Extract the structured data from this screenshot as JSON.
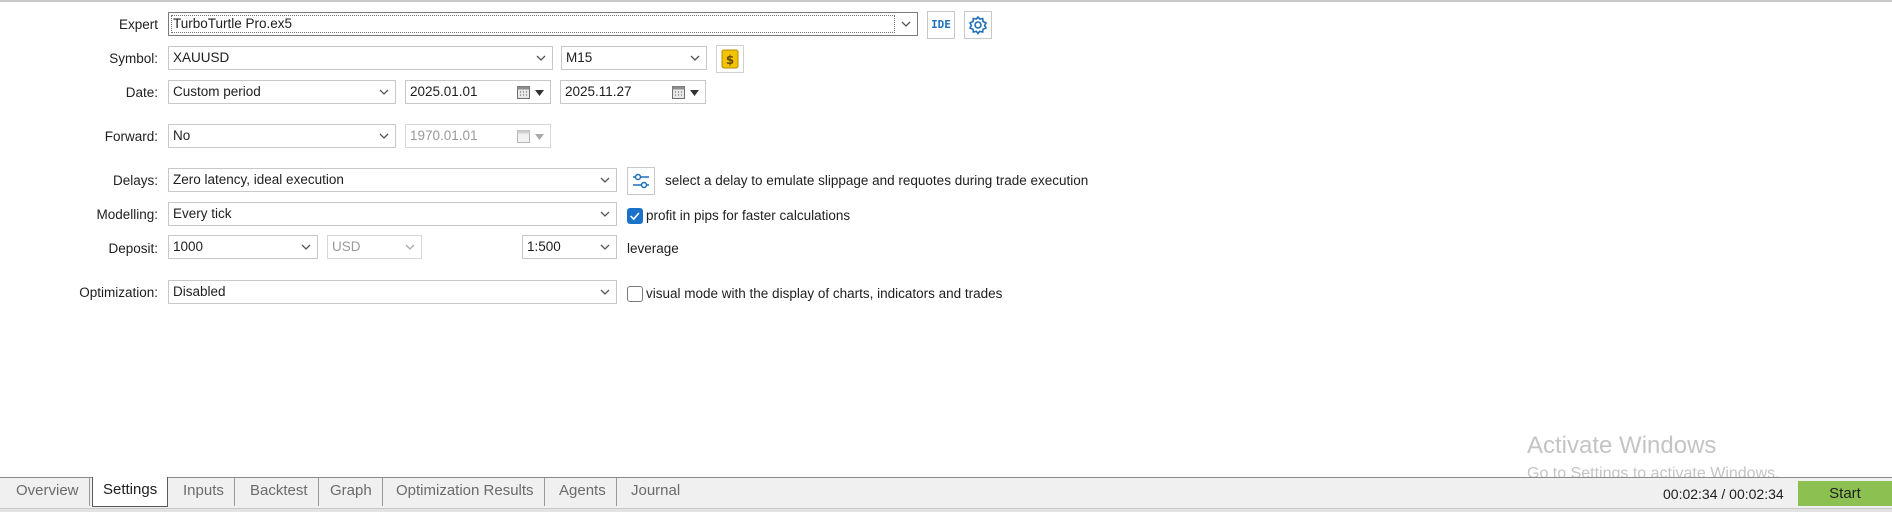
{
  "labels": {
    "expert": "Expert",
    "symbol": "Symbol:",
    "date": "Date:",
    "forward": "Forward:",
    "delays": "Delays:",
    "modelling": "Modelling:",
    "deposit": "Deposit:",
    "optimization": "Optimization:"
  },
  "expert": {
    "value": "TurboTurtle Pro.ex5",
    "ide_label": "IDE",
    "icons": [
      "ide-icon",
      "settings-gear-icon"
    ]
  },
  "symbol": {
    "value": "XAUUSD",
    "timeframe": "M15",
    "icon": "symbol-properties-dollar-icon",
    "accent": "#f2c400"
  },
  "date": {
    "period": "Custom period",
    "from": "2025.01.01",
    "to": "2025.11.27"
  },
  "forward": {
    "value": "No",
    "date": "1970.01.01"
  },
  "delays": {
    "value": "Zero latency, ideal execution",
    "hint": "select a delay to emulate slippage and requotes during trade execution",
    "icon": "delay-settings-icon"
  },
  "modelling": {
    "value": "Every tick",
    "profit_in_pips_label": "profit in pips for faster calculations",
    "profit_in_pips_checked": true
  },
  "deposit": {
    "amount": "1000",
    "currency": "USD",
    "leverage_value": "1:500",
    "leverage_label": "leverage"
  },
  "optimization": {
    "value": "Disabled",
    "visual_mode_label": "visual mode with the display of charts, indicators and trades",
    "visual_mode_checked": false
  },
  "watermark": {
    "title": "Activate Windows",
    "subtitle": "Go to Settings to activate Windows."
  },
  "tabs": [
    {
      "label": "Overview",
      "active": false
    },
    {
      "label": "Settings",
      "active": true
    },
    {
      "label": "Inputs",
      "active": false
    },
    {
      "label": "Backtest",
      "active": false
    },
    {
      "label": "Graph",
      "active": false
    },
    {
      "label": "Optimization Results",
      "active": false
    },
    {
      "label": "Agents",
      "active": false
    },
    {
      "label": "Journal",
      "active": false
    }
  ],
  "status": {
    "timer": "00:02:34 / 00:02:34",
    "start_label": "Start",
    "start_color": "#8cc152"
  }
}
